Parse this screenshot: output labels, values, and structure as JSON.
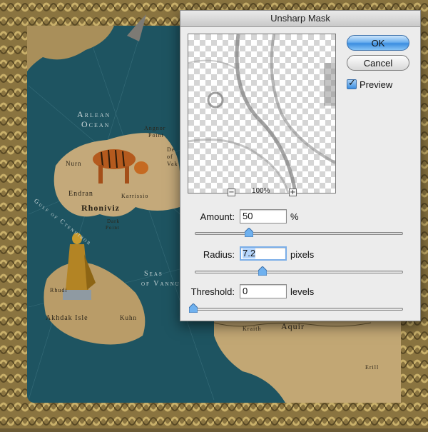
{
  "dialog": {
    "title": "Unsharp Mask",
    "ok_label": "OK",
    "cancel_label": "Cancel",
    "preview_label": "Preview",
    "preview_checked": true,
    "zoom": {
      "level": "100%",
      "minus_label": "−",
      "plus_label": "+"
    },
    "amount": {
      "label": "Amount:",
      "value": "50",
      "unit": "%"
    },
    "radius": {
      "label": "Radius:",
      "value": "7.2",
      "unit": "pixels"
    },
    "threshold": {
      "label": "Threshold:",
      "value": "0",
      "unit": "levels"
    },
    "accent_color": "#3a8de0"
  },
  "map": {
    "labels": {
      "ocean_1": "Arlean",
      "ocean_2": "Ocean",
      "angnor": "Angnor",
      "point": "Point",
      "nurn": "Nurn",
      "endran": "Endran",
      "rhoniviz": "Rhoniviz",
      "karrissio": "Karrissio",
      "dark": "Dark",
      "point2": "Point",
      "gulf": "Gulf of Ctennibor",
      "seas": "Seas",
      "of_vannu": "of Vannu",
      "rhudi": "Rhudi",
      "akhdak_isle": "Akhdak Isle",
      "kuhn": "Kuhn",
      "aquir": "Aquir",
      "kraith": "Kraith",
      "erill": "Erill",
      "de": "De",
      "of": "of",
      "vak": "Vak"
    }
  }
}
